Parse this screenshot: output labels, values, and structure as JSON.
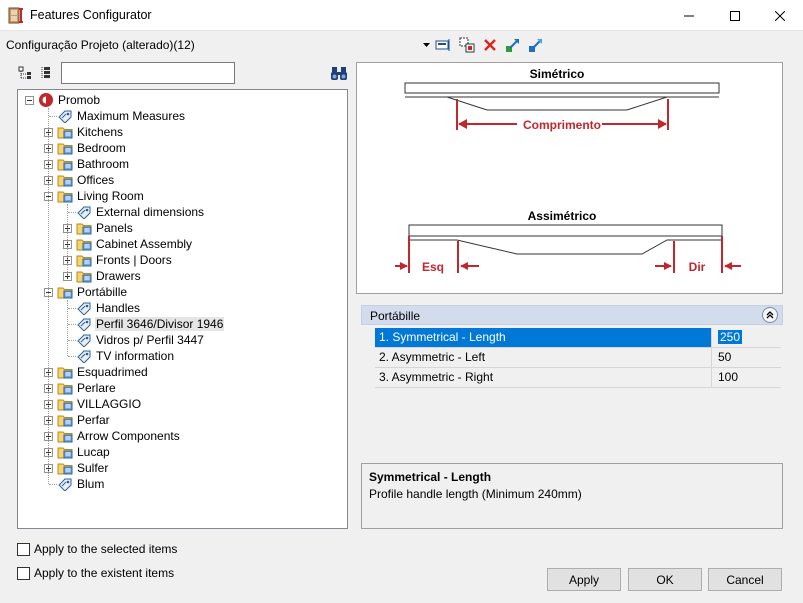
{
  "window": {
    "title": "Features Configurator",
    "controls": [
      "minimize-icon",
      "maximize-icon",
      "close-icon"
    ]
  },
  "config": {
    "label": "Configuração Projeto (alterado)(12)"
  },
  "toolbar_icons": [
    "config-edit-icon",
    "copy-config-icon",
    "delete-icon",
    "import-icon",
    "export-icon"
  ],
  "tree_tools": [
    "expand-all-icon",
    "collapse-all-icon",
    "find-icon"
  ],
  "search": {
    "value": "",
    "placeholder": ""
  },
  "tree": {
    "root": "Promob",
    "items": [
      {
        "label": "Maximum Measures",
        "type": "tag"
      },
      {
        "label": "Kitchens",
        "type": "folder"
      },
      {
        "label": "Bedroom",
        "type": "folder"
      },
      {
        "label": "Bathroom",
        "type": "folder"
      },
      {
        "label": "Offices",
        "type": "folder"
      },
      {
        "label": "Living Room",
        "type": "folder",
        "expanded": true
      },
      {
        "label": "External dimensions",
        "type": "tag",
        "level": 2
      },
      {
        "label": "Panels",
        "type": "folder",
        "level": 2
      },
      {
        "label": "Cabinet Assembly",
        "type": "folder",
        "level": 2
      },
      {
        "label": "Fronts | Doors",
        "type": "folder",
        "level": 2
      },
      {
        "label": "Drawers",
        "type": "folder",
        "level": 2
      },
      {
        "label": "Portábille",
        "type": "folder",
        "expanded": true
      },
      {
        "label": "Handles",
        "type": "tag",
        "level": 2
      },
      {
        "label": "Perfil 3646/Divisor 1946",
        "type": "tag",
        "level": 2,
        "selected": true
      },
      {
        "label": "Vidros p/ Perfil 3447",
        "type": "tag",
        "level": 2
      },
      {
        "label": "TV information",
        "type": "tag",
        "level": 2
      },
      {
        "label": "Esquadrimed",
        "type": "folder"
      },
      {
        "label": "Perlare",
        "type": "folder"
      },
      {
        "label": "VILLAGGIO",
        "type": "folder"
      },
      {
        "label": "Perfar",
        "type": "folder"
      },
      {
        "label": "Arrow Components",
        "type": "folder"
      },
      {
        "label": "Lucap",
        "type": "folder"
      },
      {
        "label": "Sulfer",
        "type": "folder"
      },
      {
        "label": "Blum",
        "type": "tag"
      }
    ]
  },
  "diagram": {
    "sym_title": "Simétrico",
    "sym_dim": "Comprimento",
    "asym_title": "Assimétrico",
    "left_label": "Esq",
    "right_label": "Dir"
  },
  "property_grid": {
    "category": "Portábille",
    "rows": [
      {
        "name": "1. Symmetrical - Length",
        "value": "250",
        "selected": true
      },
      {
        "name": "2. Asymmetric - Left",
        "value": "50"
      },
      {
        "name": "3. Asymmetric - Right",
        "value": "100"
      }
    ]
  },
  "help": {
    "title": "Symmetrical - Length",
    "description": "Profile handle length (Minimum 240mm)"
  },
  "options": {
    "apply_selected": "Apply to the selected items",
    "apply_existent": "Apply to the existent items"
  },
  "buttons": {
    "apply": "Apply",
    "ok": "OK",
    "cancel": "Cancel"
  },
  "colors": {
    "accent_red": "#c1272d",
    "selection": "#0078d7",
    "category_bg": "#d3dcec"
  }
}
